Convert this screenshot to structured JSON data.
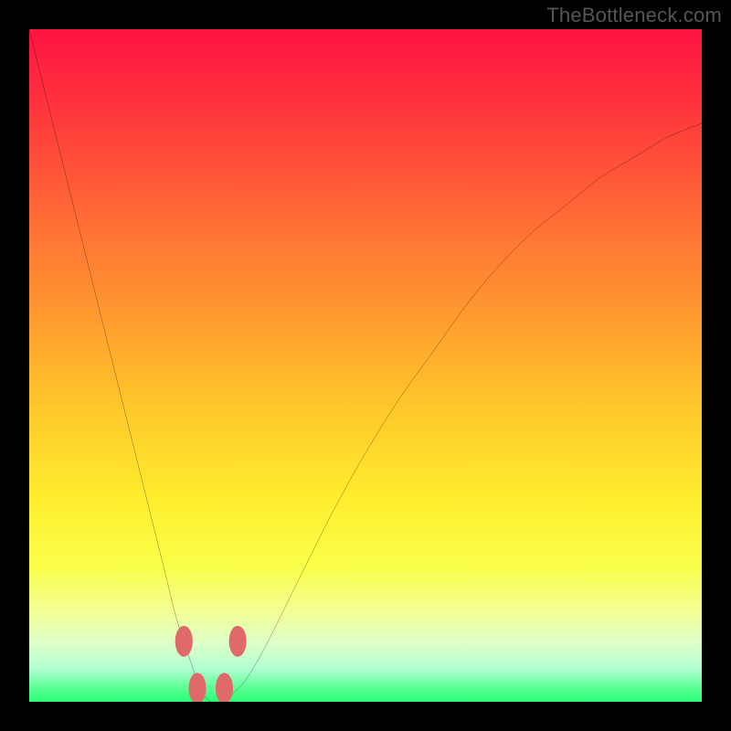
{
  "watermark": "TheBottleneck.com",
  "chart_data": {
    "type": "line",
    "title": "",
    "xlabel": "",
    "ylabel": "",
    "xlim": [
      0,
      100
    ],
    "ylim": [
      0,
      100
    ],
    "grid": false,
    "series": [
      {
        "name": "bottleneck-curve",
        "x": [
          0,
          2,
          5,
          8,
          11,
          14,
          17,
          20,
          22,
          24,
          25,
          26,
          27,
          28,
          29,
          30,
          32,
          35,
          40,
          45,
          50,
          55,
          60,
          65,
          70,
          75,
          80,
          85,
          90,
          95,
          100
        ],
        "y": [
          100,
          92,
          80,
          68,
          56,
          44,
          32,
          20,
          12,
          6,
          3,
          1,
          0,
          0,
          0,
          1,
          3,
          8,
          18,
          28,
          37,
          45,
          52,
          59,
          65,
          70,
          74,
          78,
          81,
          84,
          86
        ]
      }
    ],
    "markers": [
      {
        "name": "left-upper-marker",
        "x": 23,
        "y": 9
      },
      {
        "name": "left-lower-marker",
        "x": 25,
        "y": 2
      },
      {
        "name": "right-lower-marker",
        "x": 29,
        "y": 2
      },
      {
        "name": "right-upper-marker",
        "x": 31,
        "y": 9
      }
    ],
    "colors": {
      "curve": "#000000",
      "marker": "#e06a6a",
      "background_top": "#ff1442",
      "background_bottom": "#29ff76"
    }
  }
}
